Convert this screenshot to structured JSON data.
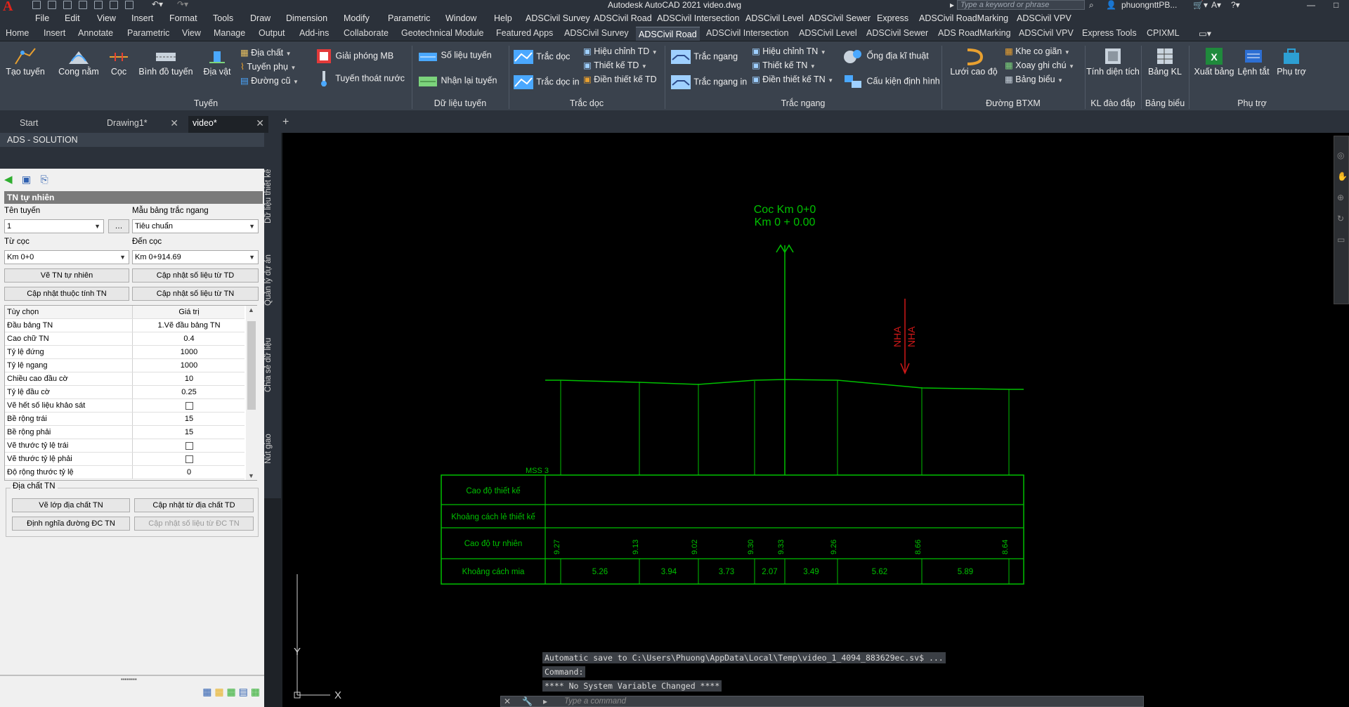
{
  "title_bar": {
    "app_title": "Autodesk AutoCAD 2021   video.dwg",
    "search_placeholder": "Type a keyword or phrase",
    "user": "phuongnttPB..."
  },
  "menu": [
    "File",
    "Edit",
    "View",
    "Insert",
    "Format",
    "Tools",
    "Draw",
    "Dimension",
    "Modify",
    "Parametric",
    "Window",
    "Help",
    "ADSCivil Survey",
    "ADSCivil Road",
    "ADSCivil Intersection",
    "ADSCivil Level",
    "ADSCivil Sewer",
    "Express",
    "ADSCivil RoadMarking",
    "ADSCivil VPV"
  ],
  "ribbon_tabs": [
    "Home",
    "Insert",
    "Annotate",
    "Parametric",
    "View",
    "Manage",
    "Output",
    "Add-ins",
    "Collaborate",
    "Geotechnical Module",
    "Featured Apps",
    "ADSCivil Survey",
    "ADSCivil Road",
    "ADSCivil Intersection",
    "ADSCivil Level",
    "ADSCivil Sewer",
    "ADS RoadMarking",
    "ADSCivil VPV",
    "Express Tools",
    "CPIXML"
  ],
  "ribbon_active_tab": "ADSCivil Road",
  "ribbon": {
    "tao_tuyen": "Tạo tuyến",
    "cong_nam": "Cong nằm",
    "coc": "Cọc",
    "binh_do_tuyen": "Bình đồ tuyến",
    "dia_vat": "Địa vật",
    "dia_chat": "Địa chất",
    "tuyen_phu": "Tuyến phụ",
    "duong_cu": "Đường cũ",
    "giai_phong_mb": "Giải phóng MB",
    "tuyen_thoat_nuoc": "Tuyến thoát nước",
    "so_lieu_tuyen": "Số liệu tuyến",
    "nhan_lai_tuyen": "Nhận lại tuyến",
    "trac_doc": "Trắc dọc",
    "trac_doc_in": "Trắc dọc in",
    "hieu_chinh_td": "Hiệu chỉnh TD",
    "thiet_ke_td": "Thiết kế TD",
    "dien_thiet_ke_td": "Điền thiết kế TD",
    "trac_ngang": "Trắc ngang",
    "trac_ngang_in": "Trắc ngang in",
    "hieu_chinh_tn": "Hiệu chỉnh TN",
    "thiet_ke_tn": "Thiết kế TN",
    "dien_thiet_ke_tn": "Điền thiết kế TN",
    "ong_dia_ki_thuat": "Ống địa kĩ thuật",
    "cau_kien_dinh_hinh": "Cấu kiện định hình",
    "luoi_cao_do": "Lưới cao độ",
    "khe_co_gian": "Khe co giãn",
    "xoay_ghi_chu": "Xoay ghi chú",
    "bang_bieu": "Bảng biểu",
    "tinh_dien_tich": "Tính diện tích",
    "bang_kl": "Bảng KL",
    "xuat_bang": "Xuất bảng",
    "lenh_tat": "Lệnh tắt",
    "phu_tro": "Phụ trợ",
    "groups": {
      "tuyen": "Tuyến",
      "du_lieu_tuyen": "Dữ liệu tuyến",
      "trac_doc": "Trắc dọc",
      "trac_ngang": "Trắc ngang",
      "duong_btxm": "Đường BTXM",
      "kl_dao_dap": "KL đào đắp",
      "bang_bieu": "Bảng biểu",
      "phu_tro": "Phụ trợ"
    }
  },
  "doc_tabs": [
    "Start",
    "Drawing1*",
    "video*"
  ],
  "palette": {
    "title": "ADS - SOLUTION",
    "section": "TN tự nhiên",
    "ten_tuyen_label": "Tên tuyến",
    "ten_tuyen_value": "1",
    "mau_bang_label": "Mẫu bảng trắc ngang",
    "mau_bang_value": "Tiêu chuẩn",
    "tu_coc_label": "Từ cọc",
    "tu_coc_value": "Km 0+0",
    "den_coc_label": "Đến cọc",
    "den_coc_value": "Km 0+914.69",
    "btn_ve_tn": "Vẽ TN tự nhiên",
    "btn_cap_nhat_td": "Cập nhật số liệu từ TD",
    "btn_cap_nhat_thuoc_tinh": "Cập nhật thuộc tính TN",
    "btn_cap_nhat_tn": "Cập nhật số liệu từ TN",
    "grid_header": [
      "Tùy chọn",
      "Giá trị"
    ],
    "grid_rows": [
      {
        "k": "Đầu bảng TN",
        "v": "1.Vẽ đầu bảng TN"
      },
      {
        "k": "Cao chữ TN",
        "v": "0.4"
      },
      {
        "k": "Tỷ lệ đứng",
        "v": "1000"
      },
      {
        "k": "Tỷ lệ ngang",
        "v": "1000"
      },
      {
        "k": "Chiều cao đầu cờ",
        "v": "10"
      },
      {
        "k": "Tỷ lệ đầu cờ",
        "v": "0.25"
      },
      {
        "k": "Vẽ hết số liệu khảo sát",
        "v": ""
      },
      {
        "k": "Bề rộng trái",
        "v": "15"
      },
      {
        "k": "Bề rộng phải",
        "v": "15"
      },
      {
        "k": "Vẽ thước tỷ lệ trái",
        "v": ""
      },
      {
        "k": "Vẽ thước tỷ lệ phải",
        "v": ""
      },
      {
        "k": "Độ rộng thước tỷ lệ",
        "v": "0"
      }
    ],
    "dia_chat_label": "Địa chất TN",
    "btn_ve_lop": "Vẽ lớp địa chất TN",
    "btn_cap_nhat_dia_chat": "Cập nhật từ địa chất TD",
    "btn_dinh_nghia": "Định nghĩa đường ĐC TN",
    "btn_cap_nhat_dc": "Cập nhật số liệu từ ĐC TN"
  },
  "side_tabs": [
    "Dữ liệu thiết kế",
    "Quản lý dự án",
    "Chia sẻ dữ liệu",
    "Nút giao"
  ],
  "drawing": {
    "station_line1": "Coc Km 0+0",
    "station_line2": "Km 0 + 0.00",
    "nha_left": "NHA",
    "nha_right": "NHA",
    "mss": "MSS 3",
    "row_labels": [
      "Cao độ thiết kế",
      "Khoảng cách lẻ thiết kế",
      "Cao độ tự nhiên",
      "Khoảng cách mia"
    ],
    "elevations": [
      "9.27",
      "9.13",
      "9.02",
      "9.30",
      "9.33",
      "9.26",
      "8.66",
      "8.64"
    ],
    "distances": [
      "5.26",
      "3.94",
      "3.73",
      "2.07",
      "3.49",
      "5.62",
      "5.89"
    ],
    "colors": {
      "line": "#00c000",
      "red": "#d01818"
    }
  },
  "command": {
    "line1": "Automatic save to C:\\Users\\Phuong\\AppData\\Local\\Temp\\video_1_4094_883629ec.sv$ ...",
    "line2": "Command:",
    "line3": "**** No System Variable Changed ****",
    "placeholder": "Type a command"
  }
}
